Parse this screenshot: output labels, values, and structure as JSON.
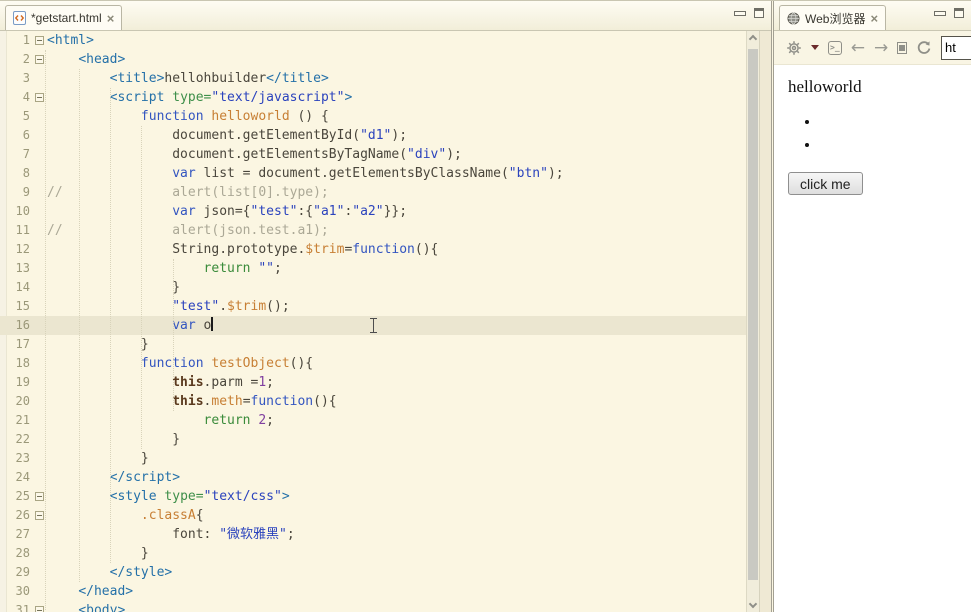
{
  "colors": {
    "tag": "#2470A8",
    "attr": "#3E8F4A",
    "string": "#2B43BD",
    "keyword": "#3355C0",
    "flow_keyword": "#3A8B3A",
    "function_name": "#C77F34",
    "number": "#8040A0",
    "comment": "#ABA896",
    "plain": "#4A463C",
    "this_keyword": "#5B3A1E",
    "editor_bg": "#FBF6E2",
    "current_line_bg": "#EBE6D0"
  },
  "editor": {
    "tab_title": "*getstart.html",
    "tab_icon": "html-file-icon",
    "close_glyph": "×",
    "current_line": 16,
    "lines": [
      {
        "num": 1,
        "fold": true,
        "tokens": [
          [
            "t",
            "<html>"
          ]
        ]
      },
      {
        "num": 2,
        "fold": true,
        "tokens": [
          [
            "p",
            "    "
          ],
          [
            "t",
            "<head>"
          ]
        ]
      },
      {
        "num": 3,
        "tokens": [
          [
            "p",
            "        "
          ],
          [
            "t",
            "<title>"
          ],
          [
            "p",
            "hellohbuilder"
          ],
          [
            "t",
            "</title>"
          ]
        ]
      },
      {
        "num": 4,
        "fold": true,
        "tokens": [
          [
            "p",
            "        "
          ],
          [
            "t",
            "<script "
          ],
          [
            "a",
            "type="
          ],
          [
            "s",
            "\"text/javascript\""
          ],
          [
            "t",
            ">"
          ]
        ]
      },
      {
        "num": 5,
        "tokens": [
          [
            "p",
            "            "
          ],
          [
            "k",
            "function "
          ],
          [
            "f",
            "helloworld"
          ],
          [
            "p",
            " () {"
          ]
        ]
      },
      {
        "num": 6,
        "tokens": [
          [
            "p",
            "                "
          ],
          [
            "p",
            "document.getElementById("
          ],
          [
            "s",
            "\"d1\""
          ],
          [
            "p",
            ");"
          ]
        ]
      },
      {
        "num": 7,
        "tokens": [
          [
            "p",
            "                "
          ],
          [
            "p",
            "document.getElementsByTagName("
          ],
          [
            "s",
            "\"div\""
          ],
          [
            "p",
            ");"
          ]
        ]
      },
      {
        "num": 8,
        "tokens": [
          [
            "p",
            "                "
          ],
          [
            "k",
            "var"
          ],
          [
            "p",
            " list = document.getElementsByClassName("
          ],
          [
            "s",
            "\"btn\""
          ],
          [
            "p",
            ");"
          ]
        ]
      },
      {
        "num": 9,
        "tokens": [
          [
            "c",
            "//              alert(list[0].type);"
          ]
        ]
      },
      {
        "num": 10,
        "tokens": [
          [
            "p",
            "                "
          ],
          [
            "k",
            "var"
          ],
          [
            "p",
            " json={"
          ],
          [
            "s",
            "\"test\""
          ],
          [
            "p",
            ":{"
          ],
          [
            "s",
            "\"a1\""
          ],
          [
            "p",
            ":"
          ],
          [
            "s",
            "\"a2\""
          ],
          [
            "p",
            "}};"
          ]
        ]
      },
      {
        "num": 11,
        "tokens": [
          [
            "c",
            "//              alert(json.test.a1);"
          ]
        ]
      },
      {
        "num": 12,
        "tokens": [
          [
            "p",
            "                "
          ],
          [
            "p",
            "String.prototype."
          ],
          [
            "f",
            "$trim"
          ],
          [
            "p",
            "="
          ],
          [
            "k",
            "function"
          ],
          [
            "p",
            "(){"
          ]
        ]
      },
      {
        "num": 13,
        "tokens": [
          [
            "p",
            "                    "
          ],
          [
            "r",
            "return"
          ],
          [
            "p",
            " "
          ],
          [
            "s",
            "\"\""
          ],
          [
            "p",
            ";"
          ]
        ]
      },
      {
        "num": 14,
        "tokens": [
          [
            "p",
            "                "
          ],
          [
            "p",
            "}"
          ]
        ]
      },
      {
        "num": 15,
        "tokens": [
          [
            "p",
            "                "
          ],
          [
            "s",
            "\"test\""
          ],
          [
            "p",
            "."
          ],
          [
            "f",
            "$trim"
          ],
          [
            "p",
            "();"
          ]
        ]
      },
      {
        "num": 16,
        "caret": true,
        "tokens": [
          [
            "p",
            "                "
          ],
          [
            "k",
            "var"
          ],
          [
            "p",
            " o"
          ]
        ]
      },
      {
        "num": 17,
        "tokens": [
          [
            "p",
            "            "
          ],
          [
            "p",
            "}"
          ]
        ]
      },
      {
        "num": 18,
        "tokens": [
          [
            "p",
            "            "
          ],
          [
            "k",
            "function "
          ],
          [
            "f",
            "testObject"
          ],
          [
            "p",
            "(){"
          ]
        ]
      },
      {
        "num": 19,
        "tokens": [
          [
            "p",
            "                "
          ],
          [
            "h",
            "this"
          ],
          [
            "p",
            ".parm ="
          ],
          [
            "n",
            "1"
          ],
          [
            "p",
            ";"
          ]
        ]
      },
      {
        "num": 20,
        "tokens": [
          [
            "p",
            "                "
          ],
          [
            "h",
            "this"
          ],
          [
            "p",
            "."
          ],
          [
            "f",
            "meth"
          ],
          [
            "p",
            "="
          ],
          [
            "k",
            "function"
          ],
          [
            "p",
            "(){"
          ]
        ]
      },
      {
        "num": 21,
        "tokens": [
          [
            "p",
            "                    "
          ],
          [
            "r",
            "return "
          ],
          [
            "n",
            "2"
          ],
          [
            "p",
            ";"
          ]
        ]
      },
      {
        "num": 22,
        "tokens": [
          [
            "p",
            "                "
          ],
          [
            "p",
            "}"
          ]
        ]
      },
      {
        "num": 23,
        "tokens": [
          [
            "p",
            "            "
          ],
          [
            "p",
            "}"
          ]
        ]
      },
      {
        "num": 24,
        "tokens": [
          [
            "p",
            "        "
          ],
          [
            "t",
            "</script>"
          ]
        ]
      },
      {
        "num": 25,
        "fold": true,
        "tokens": [
          [
            "p",
            "        "
          ],
          [
            "t",
            "<style "
          ],
          [
            "a",
            "type="
          ],
          [
            "s",
            "\"text/css\""
          ],
          [
            "t",
            ">"
          ]
        ]
      },
      {
        "num": 26,
        "fold": true,
        "tokens": [
          [
            "p",
            "            "
          ],
          [
            "f",
            ".classA"
          ],
          [
            "p",
            "{"
          ]
        ]
      },
      {
        "num": 27,
        "tokens": [
          [
            "p",
            "                "
          ],
          [
            "p",
            "font: "
          ],
          [
            "s",
            "\"微软雅黑\""
          ],
          [
            "p",
            ";"
          ]
        ]
      },
      {
        "num": 28,
        "tokens": [
          [
            "p",
            "            "
          ],
          [
            "p",
            "}"
          ]
        ]
      },
      {
        "num": 29,
        "tokens": [
          [
            "p",
            "        "
          ],
          [
            "t",
            "</style>"
          ]
        ]
      },
      {
        "num": 30,
        "tokens": [
          [
            "p",
            "    "
          ],
          [
            "t",
            "</head>"
          ]
        ]
      },
      {
        "num": 31,
        "fold": true,
        "tokens": [
          [
            "p",
            "    "
          ],
          [
            "t",
            "<body>"
          ]
        ]
      }
    ]
  },
  "browser": {
    "tab_title": "Web浏览器",
    "tab_icon": "globe-icon",
    "close_glyph": "×",
    "toolbar_icons": [
      "settings-gear-icon",
      "dropdown-caret-icon",
      "console-icon",
      "back-arrow-icon",
      "forward-arrow-icon",
      "stop-icon",
      "refresh-icon"
    ],
    "back_glyph": "←",
    "forward_glyph": "→",
    "console_glyph": ">_",
    "url_value": "ht",
    "content": {
      "heading": "helloworld",
      "list_item_count": 2,
      "button_label": "click me"
    }
  }
}
